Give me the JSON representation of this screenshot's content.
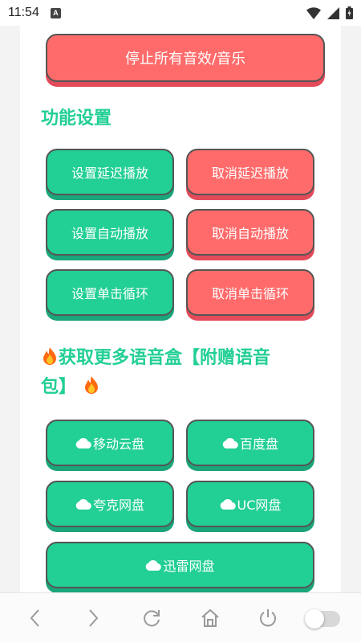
{
  "status_bar": {
    "time": "11:54",
    "notification_icon": "A"
  },
  "buttons": {
    "stop_all": "停止所有音效/音乐"
  },
  "settings": {
    "title": "功能设置",
    "set_delay": "设置延迟播放",
    "cancel_delay": "取消延迟播放",
    "set_auto": "设置自动播放",
    "cancel_auto": "取消自动播放",
    "set_loop": "设置单击循环",
    "cancel_loop": "取消单击循环"
  },
  "more": {
    "title_line1": "获取更多语音盒【附赠语音",
    "title_line2": "包】",
    "links": [
      "移动云盘",
      "百度盘",
      "夸克网盘",
      "UC网盘",
      "迅雷网盘"
    ]
  },
  "colors": {
    "green": "#22cf94",
    "red": "#ff6b6b",
    "green_shadow": "#1aa57a",
    "red_shadow": "#e34b5a"
  },
  "icons": [
    "wifi-icon",
    "signal-icon",
    "battery-icon",
    "back-icon",
    "forward-icon",
    "refresh-icon",
    "home-icon",
    "power-icon",
    "cloud-icon",
    "fire-icon"
  ]
}
